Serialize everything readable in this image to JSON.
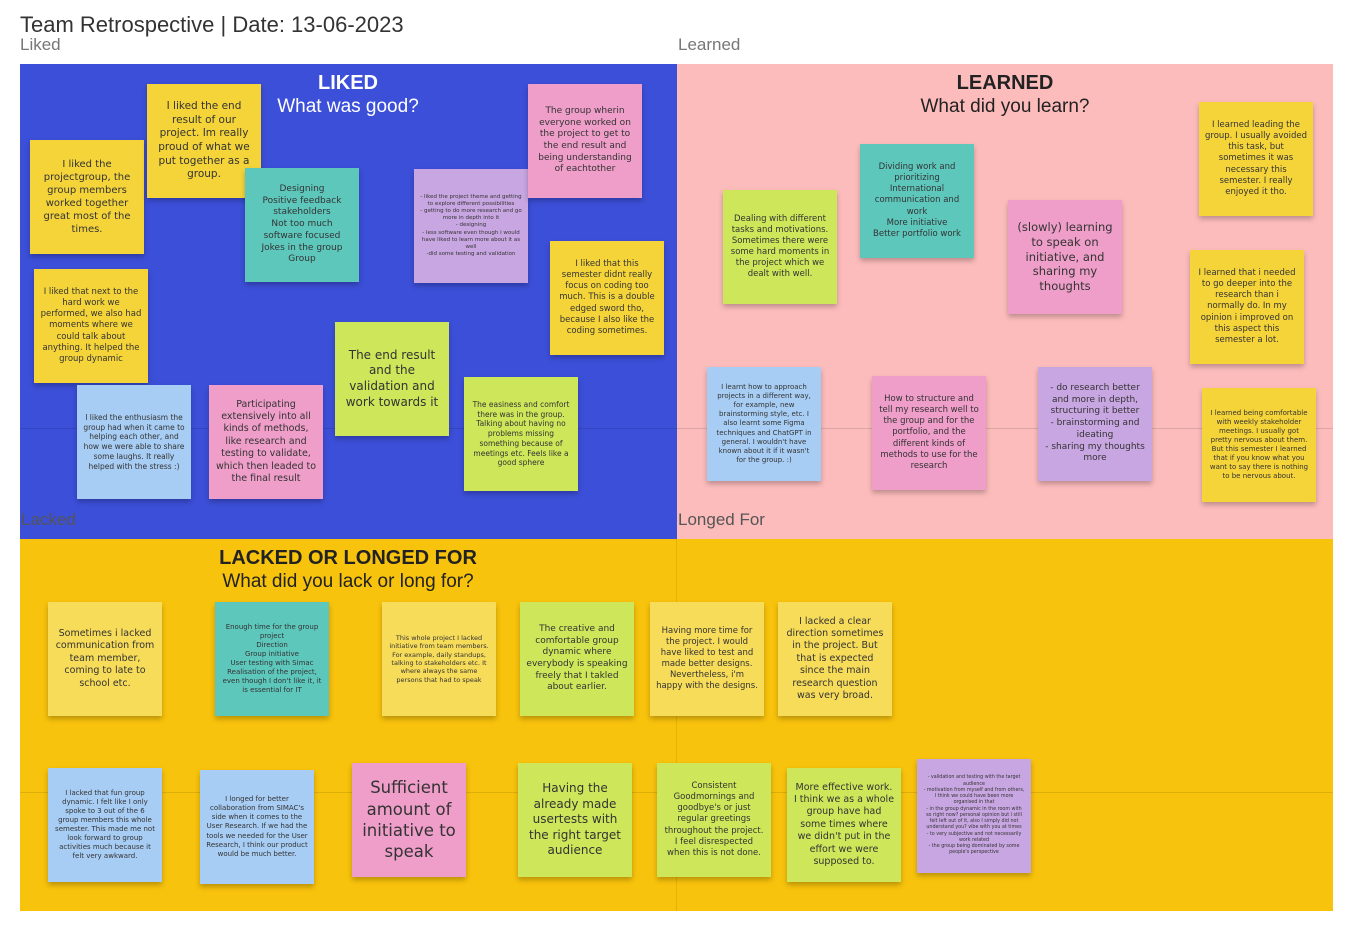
{
  "board": {
    "title": "Team Retrospective | Date: 13-06-2023",
    "frames": {
      "liked": "Liked",
      "learned": "Learned",
      "lacked": "Lacked",
      "longed_for": "Longed For"
    }
  },
  "colors": {
    "liked_bg": "#3c4fd9",
    "learned_bg": "#fdbcbc",
    "lacked_bg": "#f8c30c"
  },
  "quadrants": {
    "liked": {
      "heading": "LIKED",
      "subheading": "What was good?"
    },
    "learned": {
      "heading": "LEARNED",
      "subheading": "What did you learn?"
    },
    "lacked": {
      "heading": "LACKED OR LONGED FOR",
      "subheading": "What did you lack or long for?"
    }
  },
  "notes": {
    "n1": "I liked the projectgroup, the group members worked together great most of the times.",
    "n2": "I liked the end result of our project. Im really proud of what we put together as a group.",
    "n3": "Designing\nPositive feedback stakeholders\nNot too much software focused\nJokes in the group\nGroup",
    "n4": "- liked the project theme and getting to explore different possibilities\n- getting to do more research and go more in depth into it\n- designing\n- less software even though i would have liked to learn more about it as well\n-did some testing and validation",
    "n5": "The group wherin everyone worked on the project to get to the end result and being understanding of eachtother",
    "n6": "I liked that next to the hard work we performed, we also had moments where we could talk about anything. It helped the group dynamic",
    "n7": "I liked that this semester didnt really focus on coding too much. This is a double edged sword tho, because I also like the coding sometimes.",
    "n8": "The end result and the validation and work towards it",
    "n9": "I liked the enthusiasm the group had when it came to helping each other, and how we were able to share some laughs. It really helped with the stress :)",
    "n10": "Participating extensively into all kinds of methods, like research and testing to validate, which then leaded to the final result",
    "n11": "The easiness and comfort there was in the group. Talking about having no problems missing something because of meetings etc. Feels like a good sphere",
    "n12": "Dealing with different tasks and motivations. Sometimes there were some hard moments in the project which we dealt with well.",
    "n13": "Dividing work and prioritizing\nInternational communication and work\nMore initiative\nBetter portfolio work",
    "n14": "(slowly) learning to speak on initiative, and sharing my thoughts",
    "n15": "I learned leading the group. I usually avoided this task, but sometimes it was necessary this semester. I really enjoyed it tho.",
    "n16": "I learned that i needed to go deeper into the research than i normally do. In my opinion i improved on this aspect this semester a lot.",
    "n17": "I learnt how to approach projects in a different way, for example, new brainstorming style, etc. I also learnt some Figma techniques and ChatGPT in general. I wouldn't have known about it if it wasn't for the group. :)",
    "n18": "How to structure and tell my research well to the group and for the portfolio, and the different kinds of methods to use for the research",
    "n19": "- do research better and more in depth, structuring it better\n- brainstorming and ideating\n- sharing my thoughts more",
    "n20": "I learned being comfortable with weekly stakeholder meetings. I usually got pretty nervous about them. But this semester I learned that if you know what you want to say there is nothing to be nervous about.",
    "n21": "Sometimes i lacked communication from team member, coming to late to school etc.",
    "n22": "Enough time for the group project\nDirection\nGroup initiative\nUser testing with Simac\nRealisation of the project, even though I don't like it, it is essential for IT",
    "n23": "This whole project I lacked initiative from team members. For example, daily standups, talking to stakeholders etc. It where always the same persons that had to speak",
    "n24": "The creative and comfortable group dynamic where everybody is speaking freely that I takled about earlier.",
    "n25": "Having more time for the project. I would have liked to test and made better designs. Nevertheless, i'm happy with the designs.",
    "n26": "I lacked a clear direction sometimes in the project. But that is expected since the main research question was very broad.",
    "n27": "I lacked that fun group dynamic. I felt like I only spoke to 3 out of the 6 group members this whole semester. This made me not look forward to group activities much because it felt very awkward.",
    "n28": "I longed for better collaboration from SIMAC's side when it comes to the User Research. If we had the tools we needed for the User Research, I think our product would be much better.",
    "n29": "Sufficient amount of initiative to speak",
    "n30": "Having the already made usertests with the right target audience",
    "n31": "Consistent Goodmornings and goodbye's or just regular greetings throughout the project. I feel disrespected when this is not done.",
    "n32": "More effective work. I think we as a whole group have had some times where we didn't put in the effort we were supposed to.",
    "n33": "- validation and testing with the target audience\n- motivation from myself and from others, I think we could have been more organised in that\n- in the group dynamic in the room with so right now? personal opinion but i still felt left out of it, also I simply did not understand you? vibe with you at times\n- to very subjective and not necessarily work related\n- the group being dominated by some people's perspective"
  }
}
